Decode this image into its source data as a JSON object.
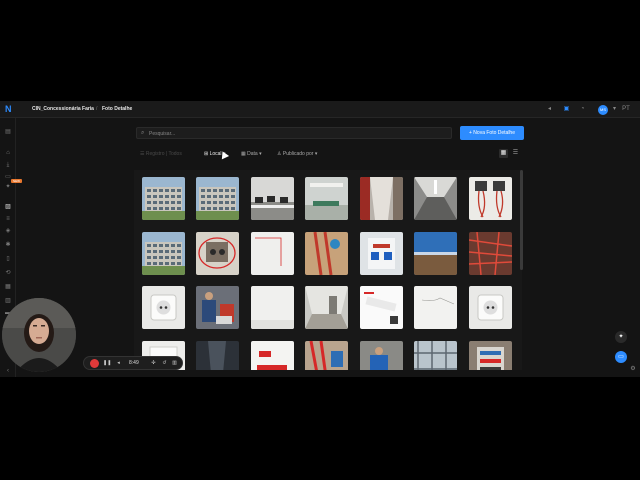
{
  "header": {
    "logo": "N",
    "breadcrumb": [
      "CIN_Concessionária Faria",
      "Foto Detalhe"
    ],
    "separator": "/",
    "avatar": "MS",
    "lang": "PT"
  },
  "sidebar": {
    "badge": "NEW",
    "icons": [
      "layout-icon",
      "home-icon",
      "download-icon",
      "chat-icon",
      "star-icon",
      "image-icon",
      "list-icon",
      "tag-icon",
      "gear-icon",
      "doc-icon",
      "share-icon",
      "calendar-icon",
      "chart-icon",
      "folder-icon",
      "settings-icon",
      "bottom-icon"
    ]
  },
  "toolbar": {
    "search_placeholder": "Pesquisar...",
    "new_button": "+ Nova Foto Detalhe"
  },
  "filters": [
    {
      "label": "Registro | Todos",
      "icon": "☰",
      "state": "dim"
    },
    {
      "label": "Local ▾",
      "icon": "⊞",
      "state": "active"
    },
    {
      "label": "Data ▾",
      "icon": "▦",
      "state": "normal"
    },
    {
      "label": "Publicado por ▾",
      "icon": "♙",
      "state": "normal"
    }
  ],
  "view_toggle": {
    "grid_icon": "▦",
    "list_icon": "☰"
  },
  "recorder": {
    "time": "8:49",
    "icons": [
      "pause-icon",
      "volume-icon",
      "grid-icon",
      "undo-icon",
      "trash-icon"
    ]
  },
  "colors": {
    "accent": "#2d8cff",
    "background": "#141414",
    "record": "#e03a3a",
    "badge": "#e8772e"
  },
  "gallery": {
    "photos": [
      "building-exterior",
      "building-exterior",
      "office-desks",
      "office-lobby",
      "corridor-red-wall",
      "ceiling-corridor",
      "electrical-wires",
      "building-exterior",
      "damaged-socket",
      "white-wall-red-mark",
      "red-pipes-brick",
      "wall-outlets",
      "landscape-sky",
      "red-conduits",
      "white-socket",
      "workers-equipment",
      "white-wall",
      "empty-room",
      "product-box",
      "cracked-wall",
      "white-socket",
      "white-panel",
      "dark-corridor",
      "red-sign-board",
      "red-pipes",
      "worker-blue",
      "scaffold",
      "electrical-panel"
    ]
  }
}
